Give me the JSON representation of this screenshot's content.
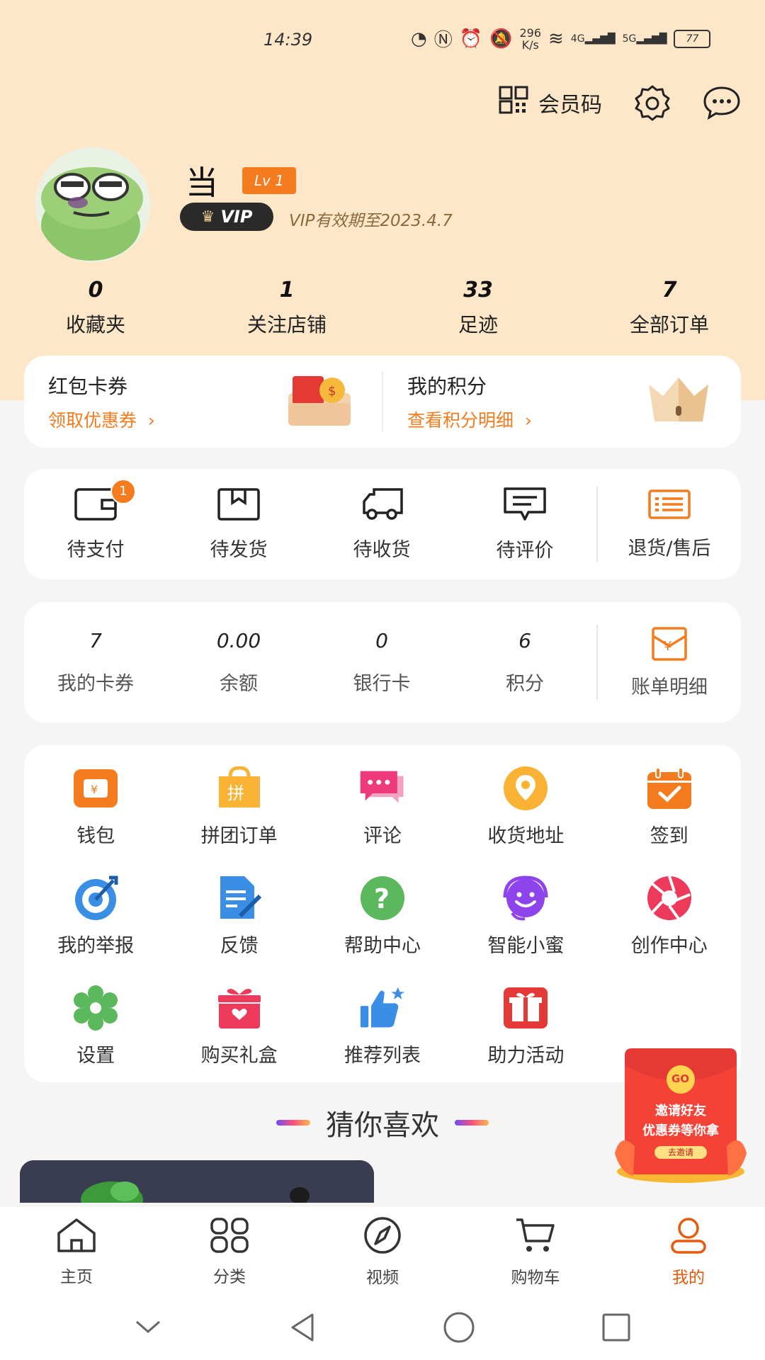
{
  "status_bar": {
    "time": "14:39",
    "net_speed": "296\nK/s",
    "net_speed_top": "296",
    "net_speed_bottom": "K/s",
    "net_4g": "4G",
    "net_5g": "5G",
    "battery": "77"
  },
  "header": {
    "member_code": "会员码"
  },
  "profile": {
    "name": "当",
    "level": "Lv 1",
    "vip": "VIP",
    "vip_expiry": "VIP有效期至2023.4.7"
  },
  "stats": [
    {
      "value": "0",
      "label": "收藏夹"
    },
    {
      "value": "1",
      "label": "关注店铺"
    },
    {
      "value": "33",
      "label": "足迹"
    },
    {
      "value": "7",
      "label": "全部订单"
    }
  ],
  "promo": {
    "left": {
      "title": "红包卡券",
      "link": "领取优惠券"
    },
    "right": {
      "title": "我的积分",
      "link": "查看积分明细"
    }
  },
  "orders": {
    "items": [
      {
        "label": "待支付",
        "icon": "wallet-icon",
        "badge": "1"
      },
      {
        "label": "待发货",
        "icon": "box-icon"
      },
      {
        "label": "待收货",
        "icon": "truck-icon"
      },
      {
        "label": "待评价",
        "icon": "comment-icon"
      }
    ],
    "after_sale": "退货/售后"
  },
  "wallet": {
    "items": [
      {
        "value": "7",
        "label": "我的卡券"
      },
      {
        "value": "0.00",
        "label": "余额"
      },
      {
        "value": "0",
        "label": "银行卡"
      },
      {
        "value": "6",
        "label": "积分"
      }
    ],
    "bill": "账单明细"
  },
  "services": [
    {
      "label": "钱包",
      "icon": "wallet-orange-icon",
      "color": "#f47b1e"
    },
    {
      "label": "拼团订单",
      "icon": "group-buy-icon",
      "color": "#f9b233"
    },
    {
      "label": "评论",
      "icon": "comment-pink-icon",
      "color": "#ee3a7a"
    },
    {
      "label": "收货地址",
      "icon": "location-icon",
      "color": "#f9b233"
    },
    {
      "label": "签到",
      "icon": "calendar-check-icon",
      "color": "#f47b1e"
    },
    {
      "label": "我的举报",
      "icon": "target-icon",
      "color": "#3a8ee6"
    },
    {
      "label": "反馈",
      "icon": "feedback-doc-icon",
      "color": "#3a8ee6"
    },
    {
      "label": "帮助中心",
      "icon": "help-icon",
      "color": "#5cb85c"
    },
    {
      "label": "智能小蜜",
      "icon": "smile-headset-icon",
      "color": "#8e44ec"
    },
    {
      "label": "创作中心",
      "icon": "aperture-icon",
      "color": "#ee3a5a"
    },
    {
      "label": "设置",
      "icon": "settings-flower-icon",
      "color": "#5cb85c"
    },
    {
      "label": "购买礼盒",
      "icon": "gift-box-icon",
      "color": "#ee3a5a"
    },
    {
      "label": "推荐列表",
      "icon": "thumbs-up-icon",
      "color": "#3a8ee6"
    },
    {
      "label": "助力活动",
      "icon": "gift-red-icon",
      "color": "#e53935"
    }
  ],
  "guess": {
    "title": "猜你喜欢"
  },
  "invite": {
    "go": "GO",
    "line1": "邀请好友",
    "line2": "优惠券等你拿",
    "button": "去邀请"
  },
  "tabs": [
    {
      "label": "主页",
      "icon": "home-icon"
    },
    {
      "label": "分类",
      "icon": "category-icon"
    },
    {
      "label": "视频",
      "icon": "compass-icon"
    },
    {
      "label": "购物车",
      "icon": "cart-icon"
    },
    {
      "label": "我的",
      "icon": "user-icon",
      "active": true
    }
  ],
  "colors": {
    "accent": "#f47b1e",
    "header_bg": "#fde7c8",
    "active_tab": "#e8590c"
  }
}
